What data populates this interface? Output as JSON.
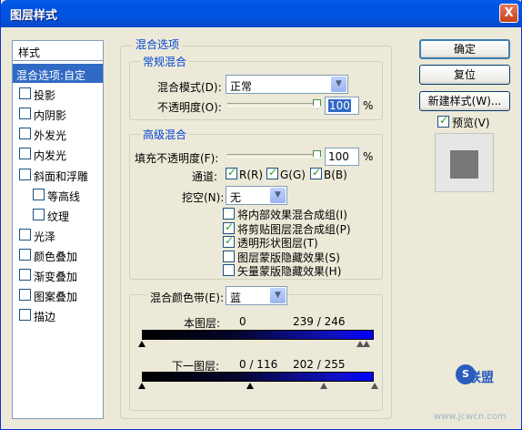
{
  "window": {
    "title": "图层样式",
    "close_glyph": "X"
  },
  "stylelist": {
    "header": "样式",
    "items": [
      {
        "label": "混合选项:自定",
        "checkbox": false,
        "selected": true
      },
      {
        "label": "投影",
        "checkbox": true,
        "checked": false
      },
      {
        "label": "内阴影",
        "checkbox": true,
        "checked": false
      },
      {
        "label": "外发光",
        "checkbox": true,
        "checked": false
      },
      {
        "label": "内发光",
        "checkbox": true,
        "checked": false
      },
      {
        "label": "斜面和浮雕",
        "checkbox": true,
        "checked": false
      },
      {
        "label": "等高线",
        "checkbox": true,
        "checked": false,
        "indent": true
      },
      {
        "label": "纹理",
        "checkbox": true,
        "checked": false,
        "indent": true
      },
      {
        "label": "光泽",
        "checkbox": true,
        "checked": false
      },
      {
        "label": "颜色叠加",
        "checkbox": true,
        "checked": false
      },
      {
        "label": "渐变叠加",
        "checkbox": true,
        "checked": false
      },
      {
        "label": "图案叠加",
        "checkbox": true,
        "checked": false
      },
      {
        "label": "描边",
        "checkbox": true,
        "checked": false
      }
    ]
  },
  "blend_options": {
    "title": "混合选项",
    "general": {
      "title": "常规混合",
      "mode_label": "混合模式(D):",
      "mode_value": "正常",
      "opacity_label": "不透明度(O):",
      "opacity_value": "100",
      "percent": "%"
    },
    "advanced": {
      "title": "高级混合",
      "fill_label": "填充不透明度(F):",
      "fill_value": "100",
      "percent": "%",
      "channels_label": "通道:",
      "channels": [
        {
          "label": "R(R)",
          "checked": true
        },
        {
          "label": "G(G)",
          "checked": true
        },
        {
          "label": "B(B)",
          "checked": true
        }
      ],
      "knockout_label": "挖空(N):",
      "knockout_value": "无",
      "options": [
        {
          "label": "将内部效果混合成组(I)",
          "checked": false
        },
        {
          "label": "将剪贴图层混合成组(P)",
          "checked": true
        },
        {
          "label": "透明形状图层(T)",
          "checked": true
        },
        {
          "label": "图层蒙版隐藏效果(S)",
          "checked": false
        },
        {
          "label": "矢量蒙版隐藏效果(H)",
          "checked": false
        }
      ]
    },
    "blend_if": {
      "label": "混合颜色带(E):",
      "value": "蓝",
      "this_layer_label": "本图层:",
      "this_layer_values": "0",
      "this_layer_values_right": "239 / 246",
      "under_layer_label": "下一图层:",
      "under_layer_values": "0 / 116",
      "under_layer_values_right": "202 / 255"
    }
  },
  "buttons": {
    "ok": "确定",
    "reset": "复位",
    "new_style": "新建样式(W)...",
    "preview_label": "预览(V)",
    "preview_checked": true
  },
  "watermark": {
    "text": "联盟",
    "url": "www.jcwcn.com"
  }
}
